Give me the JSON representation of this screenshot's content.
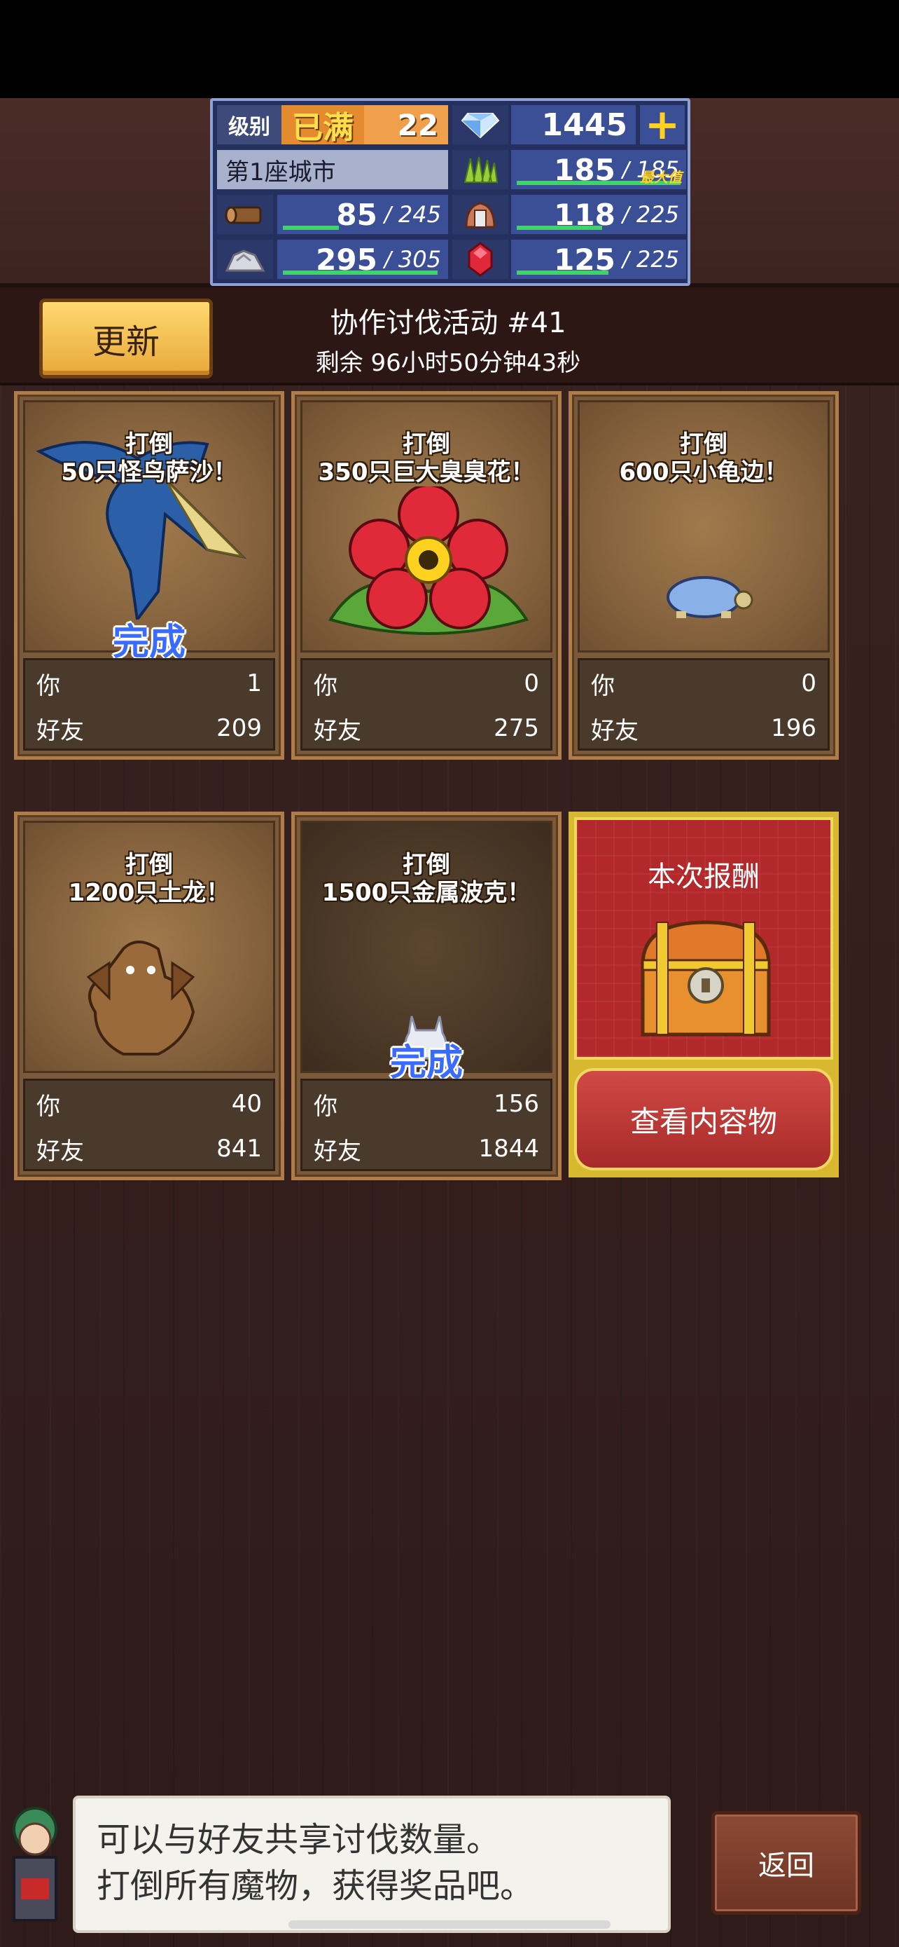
{
  "status_panel": {
    "level_label": "级别",
    "level_status": "已满",
    "level_value": "22",
    "gems": "1445",
    "plus_label": "+",
    "city_name": "第1座城市",
    "resources": [
      {
        "icon": "grass-icon",
        "current": "185",
        "max": "185",
        "tag": "最大值",
        "fill": 1.0
      },
      {
        "icon": "wood-icon",
        "current": "85",
        "max": "245",
        "fill": 0.35
      },
      {
        "icon": "food-icon",
        "current": "118",
        "max": "225",
        "fill": 0.52
      },
      {
        "icon": "ore-icon",
        "current": "295",
        "max": "305",
        "fill": 0.97
      },
      {
        "icon": "ruby-icon",
        "current": "125",
        "max": "225",
        "fill": 0.56
      }
    ]
  },
  "refresh_button": "更新",
  "event": {
    "title": "协作讨伐活动 #41",
    "remaining": "剩余 96小时50分钟43秒"
  },
  "cards": [
    {
      "title_line1": "打倒",
      "title_line2": "50只怪鸟萨沙！",
      "you_label": "你",
      "you": "1",
      "friend_label": "好友",
      "friends": "209",
      "complete": "完成",
      "monster": "bird-icon"
    },
    {
      "title_line1": "打倒",
      "title_line2": "350只巨大臭臭花！",
      "you_label": "你",
      "you": "0",
      "friend_label": "好友",
      "friends": "275",
      "complete": "",
      "monster": "flower-icon"
    },
    {
      "title_line1": "打倒",
      "title_line2": "600只小龟边！",
      "you_label": "你",
      "you": "0",
      "friend_label": "好友",
      "friends": "196",
      "complete": "",
      "monster": "turtle-icon"
    },
    {
      "title_line1": "打倒",
      "title_line2": "1200只土龙！",
      "you_label": "你",
      "you": "40",
      "friend_label": "好友",
      "friends": "841",
      "complete": "",
      "monster": "earth-dragon-icon"
    },
    {
      "title_line1": "打倒",
      "title_line2": "1500只金属波克！",
      "you_label": "你",
      "you": "156",
      "friend_label": "好友",
      "friends": "1844",
      "complete": "完成",
      "monster": "metal-bunny-icon"
    }
  ],
  "reward": {
    "title": "本次报酬",
    "button": "查看内容物",
    "icon": "treasure-chest-icon"
  },
  "dialog": {
    "line1": "可以与好友共享讨伐数量。",
    "line2": "打倒所有魔物，获得奖品吧。"
  },
  "back_button": "返回",
  "colors": {
    "accent_gold": "#e8a93a",
    "complete_blue": "#3a6bff",
    "reward_red": "#b3282a",
    "progress_green": "#3fd46a"
  }
}
